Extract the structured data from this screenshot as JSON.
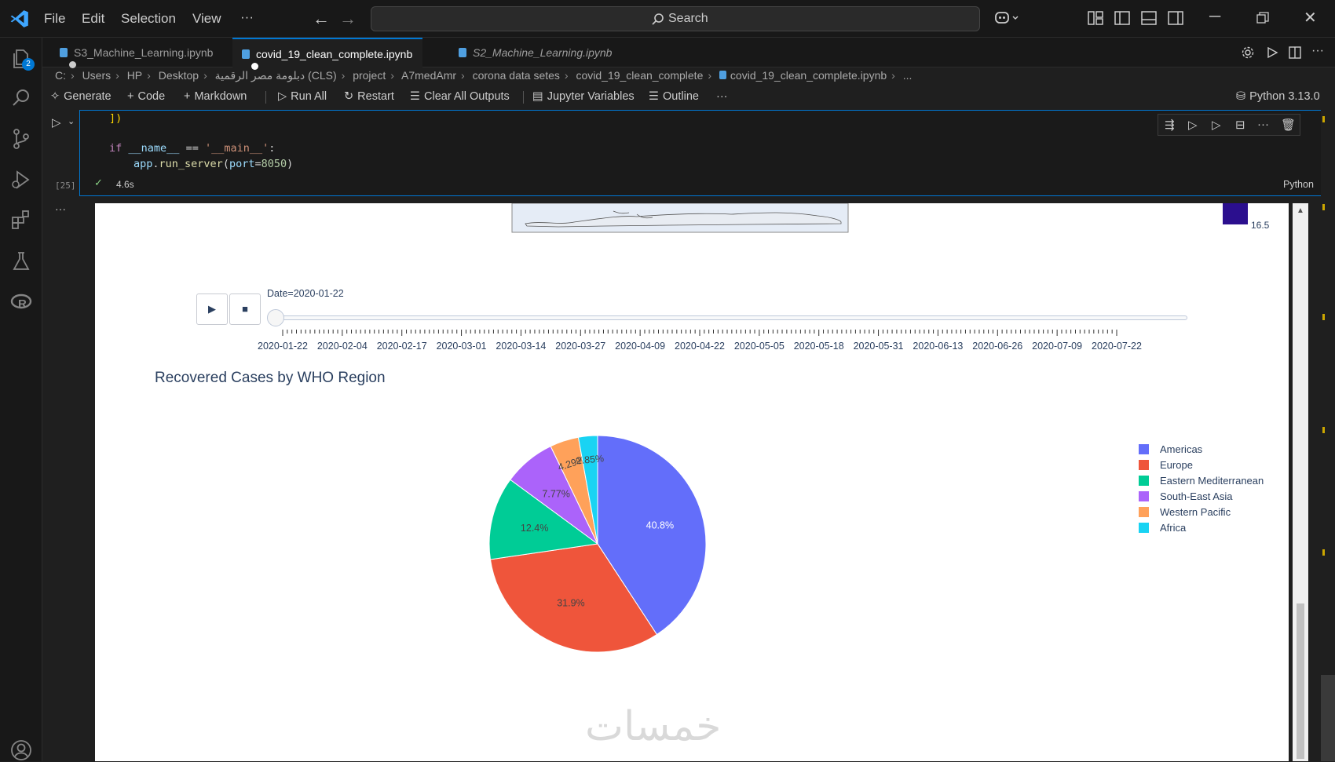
{
  "menu": [
    "File",
    "Edit",
    "Selection",
    "View",
    "···"
  ],
  "search": {
    "label": "Search"
  },
  "activity_badge": "2",
  "tabs": [
    {
      "label": "S3_Machine_Learning.ipynb"
    },
    {
      "label": "covid_19_clean_complete.ipynb"
    },
    {
      "label": "S2_Machine_Learning.ipynb"
    }
  ],
  "breadcrumb": [
    "C:",
    "Users",
    "HP",
    "Desktop",
    "دبلومة مصر الرقمية (CLS)",
    "project",
    "A7medAmr",
    "corona data setes",
    "covid_19_clean_complete",
    "covid_19_clean_complete.ipynb",
    "..."
  ],
  "toolbar": {
    "generate": "Generate",
    "code": "Code",
    "markdown": "Markdown",
    "run_all": "Run All",
    "restart": "Restart",
    "clear_outputs": "Clear All Outputs",
    "variables": "Jupyter Variables",
    "outline": "Outline",
    "more": "···",
    "kernel": "Python 3.13.0"
  },
  "cell": {
    "exec_count": "[25]",
    "duration": "4.6s",
    "language": "Python",
    "code_line1_bracket": "])",
    "code_if": "if",
    "code_name": "__name__",
    "code_eq": " == ",
    "code_main": "'__main__'",
    "code_colon": ":",
    "code_app": "app",
    "code_dot": ".",
    "code_run": "run_server",
    "code_open": "(",
    "code_port": "port",
    "code_assign": "=",
    "code_num": "8050",
    "code_close": ")"
  },
  "output": {
    "colorbar_value": "16.5",
    "slider_current": "Date=2020-01-22",
    "slider_ticks": [
      "2020-01-22",
      "2020-02-04",
      "2020-02-17",
      "2020-03-01",
      "2020-03-14",
      "2020-03-27",
      "2020-04-09",
      "2020-04-22",
      "2020-05-05",
      "2020-05-18",
      "2020-05-31",
      "2020-06-13",
      "2020-06-26",
      "2020-07-09",
      "2020-07-22"
    ],
    "play_icon": "▶",
    "stop_icon": "■",
    "watermark": "خمسات"
  },
  "chart_data": {
    "type": "pie",
    "title": "Recovered Cases by WHO Region",
    "series": [
      {
        "name": "Americas",
        "value": 40.8,
        "label": "40.8%",
        "color": "#636efa"
      },
      {
        "name": "Europe",
        "value": 31.9,
        "label": "31.9%",
        "color": "#ef553b"
      },
      {
        "name": "Eastern Mediterranean",
        "value": 12.4,
        "label": "12.4%",
        "color": "#00cc96"
      },
      {
        "name": "South-East Asia",
        "value": 7.77,
        "label": "7.77%",
        "color": "#ab63fa"
      },
      {
        "name": "Western Pacific",
        "value": 4.29,
        "label": "4.29%",
        "color": "#ffa15a"
      },
      {
        "name": "Africa",
        "value": 2.85,
        "label": "2.85%",
        "color": "#19d3f3"
      }
    ],
    "legend_position": "right"
  }
}
